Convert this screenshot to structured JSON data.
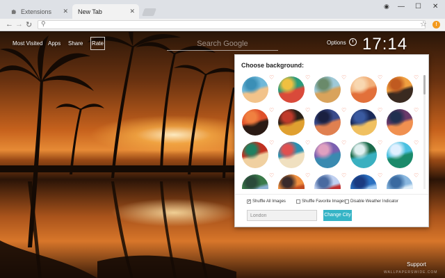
{
  "browser": {
    "tabs": [
      {
        "label": "Extensions",
        "active": false
      },
      {
        "label": "New Tab",
        "active": true
      }
    ],
    "omnibox_value": "",
    "window_controls": [
      "minimize",
      "maximize",
      "close"
    ]
  },
  "newtab": {
    "nav": {
      "most_visited": "Most Visited",
      "apps": "Apps",
      "share": "Share",
      "rate": "Rate"
    },
    "search_placeholder": "Search Google",
    "options_label": "Options",
    "clock_time": "17:14",
    "support_label": "Support",
    "watermark_text": "WALLPAPERSWIDE.COM"
  },
  "background_panel": {
    "title": "Choose background:",
    "thumbnails": [
      {
        "name": "pool-resort",
        "colors": [
          "#6fb8d9",
          "#f2c38a",
          "#3b8fb6"
        ]
      },
      {
        "name": "boats-harbor",
        "colors": [
          "#2a9b7a",
          "#d94a3a",
          "#f0c040"
        ]
      },
      {
        "name": "beach-chairs",
        "colors": [
          "#9ec9d8",
          "#d9a35b",
          "#6a8a6a"
        ]
      },
      {
        "name": "pier-sunset",
        "colors": [
          "#f2b07a",
          "#e2703a",
          "#f8d7b0"
        ]
      },
      {
        "name": "tropical-sunset",
        "colors": [
          "#f0a040",
          "#3a2a20",
          "#c05a20"
        ]
      },
      {
        "name": "woman-silhouette",
        "colors": [
          "#e0502a",
          "#2a1a14",
          "#f08040"
        ]
      },
      {
        "name": "fruit-plate",
        "colors": [
          "#2a2018",
          "#e0a030",
          "#c03a2a"
        ]
      },
      {
        "name": "dusk-shore",
        "colors": [
          "#3a4a8a",
          "#e08050",
          "#1a2040"
        ]
      },
      {
        "name": "night-city",
        "colors": [
          "#1a2a5a",
          "#f0c060",
          "#3a5aa0"
        ]
      },
      {
        "name": "dusk-lake",
        "colors": [
          "#6a3a6a",
          "#f09050",
          "#203050"
        ]
      },
      {
        "name": "carnival-mask",
        "colors": [
          "#c03020",
          "#f0d0a0",
          "#208060"
        ]
      },
      {
        "name": "mandala",
        "colors": [
          "#2a90b0",
          "#f0e0c0",
          "#e05050"
        ]
      },
      {
        "name": "purple-cliffs",
        "colors": [
          "#7a60b0",
          "#3a8ab0",
          "#e0a0c0"
        ]
      },
      {
        "name": "green-cove",
        "colors": [
          "#1a6a4a",
          "#3ab0c0",
          "#e0f0f0"
        ]
      },
      {
        "name": "lagoon",
        "colors": [
          "#4ac0e0",
          "#1a8a6a",
          "#e0f0ff"
        ]
      },
      {
        "name": "mountain-green",
        "colors": [
          "#3a7a4a",
          "#8ab0d0",
          "#2a4a3a"
        ]
      },
      {
        "name": "orange-sky",
        "colors": [
          "#f09040",
          "#c04a20",
          "#3a2a2a"
        ]
      },
      {
        "name": "lighthouse",
        "colors": [
          "#c0d0f0",
          "#c03030",
          "#4a6aa0"
        ]
      },
      {
        "name": "ocean-blue",
        "colors": [
          "#2a70c0",
          "#a0c8f0",
          "#1a3a80"
        ]
      },
      {
        "name": "sky-clouds",
        "colors": [
          "#8ab8e0",
          "#e0eef8",
          "#3a6aa0"
        ]
      }
    ],
    "options": {
      "shuffle_all": {
        "label": "Shuffle All Images",
        "checked": true
      },
      "shuffle_favorite": {
        "label": "Shuffle Favorite Images",
        "checked": false
      },
      "disable_weather": {
        "label": "Disable Weather Indicator",
        "checked": false
      }
    },
    "city_value": "London",
    "change_city_label": "Change City"
  },
  "colors": {
    "accent_button": "#35b4c6",
    "heart": "#f07a5a",
    "extension_badge": "#f39a1e"
  }
}
